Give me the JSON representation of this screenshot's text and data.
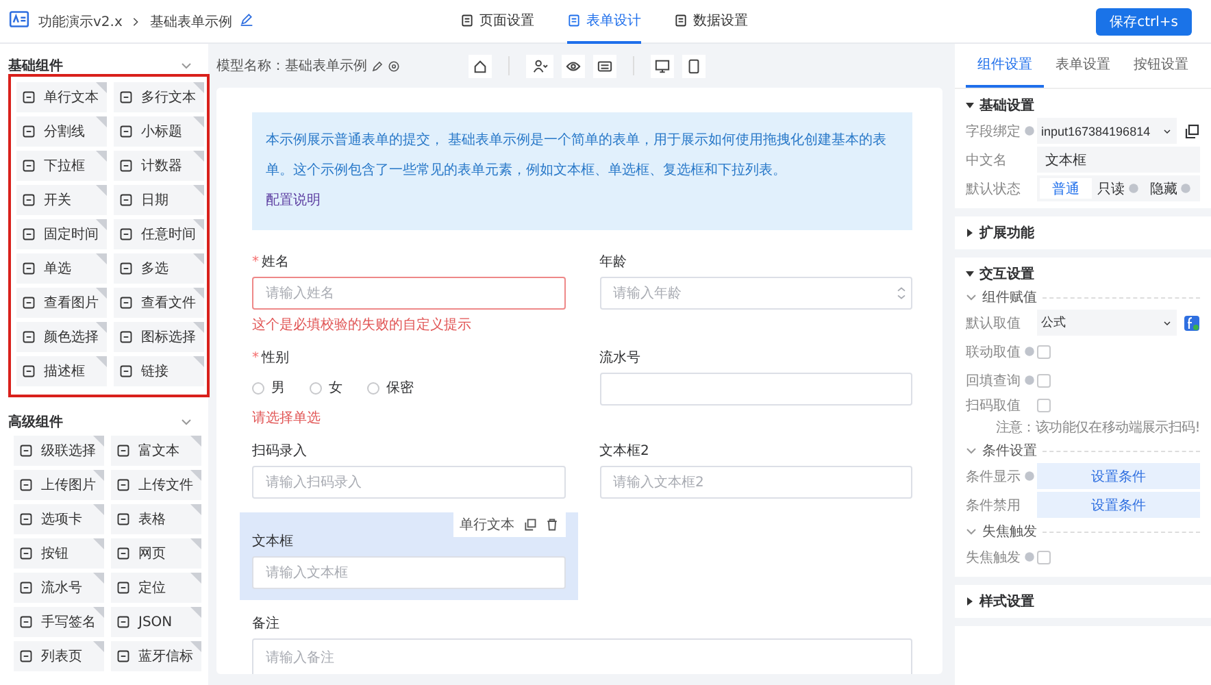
{
  "header": {
    "breadcrumb": [
      "功能演示v2.x",
      "基础表单示例"
    ],
    "tabs": [
      {
        "label": "页面设置",
        "selected": false
      },
      {
        "label": "表单设计",
        "selected": true
      },
      {
        "label": "数据设置",
        "selected": false
      }
    ],
    "save_button": "保存ctrl+s"
  },
  "palette": [
    {
      "title": "基础组件",
      "expanded": true,
      "highlighted": true,
      "items": [
        "单行文本",
        "多行文本",
        "分割线",
        "小标题",
        "下拉框",
        "计数器",
        "开关",
        "日期",
        "固定时间",
        "任意时间",
        "单选",
        "多选",
        "查看图片",
        "查看文件",
        "颜色选择",
        "图标选择",
        "描述框",
        "链接"
      ]
    },
    {
      "title": "高级组件",
      "expanded": true,
      "highlighted": false,
      "items": [
        "级联选择",
        "富文本",
        "上传图片",
        "上传文件",
        "选项卡",
        "表格",
        "按钮",
        "网页",
        "流水号",
        "定位",
        "手写签名",
        "JSON",
        "列表页",
        "蓝牙信标"
      ]
    }
  ],
  "toolbar": {
    "model_name": "模型名称：基础表单示例"
  },
  "form": {
    "notice": {
      "text": "本示例展示普通表单的提交， 基础表单示例是一个简单的表单，用于展示如何使用拖拽化创建基本的表单。这个示例包含了一些常见的表单元素，例如文本框、单选框、复选框和下拉列表。",
      "link": "配置说明"
    },
    "fields": [
      {
        "kind": "input",
        "label": "姓名",
        "required_mark": "*",
        "placeholder": "请输入姓名",
        "invalid": true,
        "error": "这个是必填校验的失败的自定义提示",
        "selected": false
      },
      {
        "kind": "number",
        "label": "年龄",
        "placeholder": "请输入年龄",
        "invalid": false,
        "selected": false
      },
      {
        "kind": "radio",
        "label": "性别",
        "required_mark": "*",
        "options": [
          {
            "label": "男",
            "selected": false
          },
          {
            "label": "女",
            "selected": false
          },
          {
            "label": "保密",
            "selected": false
          }
        ],
        "error": "请选择单选",
        "selected": false
      },
      {
        "kind": "input",
        "label": "流水号",
        "invalid": false,
        "selected": false
      },
      {
        "kind": "input",
        "label": "扫码录入",
        "placeholder": "请输入扫码录入",
        "invalid": false,
        "selected": false
      },
      {
        "kind": "input",
        "label": "文本框2",
        "placeholder": "请输入文本框2",
        "invalid": false,
        "selected": false
      },
      {
        "kind": "input",
        "label": "文本框",
        "placeholder": "请输入文本框",
        "invalid": false,
        "selected": true,
        "type_tag": "单行文本"
      },
      {
        "kind": "textarea",
        "label": "备注",
        "placeholder": "请输入备注",
        "selected": false
      }
    ]
  },
  "settings": {
    "tabs": [
      {
        "label": "组件设置",
        "selected": true
      },
      {
        "label": "表单设置",
        "selected": false
      },
      {
        "label": "按钮设置",
        "selected": false
      }
    ],
    "sections": [
      {
        "title": "基础设置",
        "expanded": true,
        "groups": [
          {
            "rows": [
              {
                "kind": "binding",
                "label": "字段绑定",
                "info": true,
                "value": "input167384196814"
              },
              {
                "kind": "text",
                "label": "中文名",
                "info": false,
                "value": "文本框"
              },
              {
                "kind": "segmented",
                "label": "默认状态",
                "info": false,
                "options": [
                  {
                    "label": "普通",
                    "info": false,
                    "selected": true
                  },
                  {
                    "label": "只读",
                    "info": true,
                    "selected": false
                  },
                  {
                    "label": "隐藏",
                    "info": true,
                    "selected": false
                  }
                ]
              }
            ]
          }
        ]
      },
      {
        "title": "扩展功能",
        "expanded": false
      },
      {
        "title": "交互设置",
        "expanded": true,
        "groups": [
          {
            "title": "组件赋值",
            "expanded": true,
            "rows": [
              {
                "kind": "formula",
                "label": "默认取值",
                "info": false,
                "value": "公式"
              },
              {
                "kind": "checkbox",
                "label": "联动取值",
                "info": true,
                "checked": false
              },
              {
                "kind": "checkbox",
                "label": "回填查询",
                "info": true,
                "checked": false
              },
              {
                "kind": "checkbox",
                "label": "扫码取值",
                "info": false,
                "checked": false,
                "note": "注意：该功能仅在移动端展示扫码!"
              }
            ]
          },
          {
            "title": "条件设置",
            "expanded": true,
            "rows": [
              {
                "kind": "button",
                "label": "条件显示",
                "info": true,
                "value": "设置条件"
              },
              {
                "kind": "button",
                "label": "条件禁用",
                "info": false,
                "value": "设置条件"
              }
            ]
          },
          {
            "title": "失焦触发",
            "expanded": true,
            "rows": [
              {
                "kind": "checkbox",
                "label": "失焦触发",
                "info": true,
                "checked": false
              }
            ]
          }
        ]
      },
      {
        "title": "样式设置",
        "expanded": false
      }
    ]
  }
}
